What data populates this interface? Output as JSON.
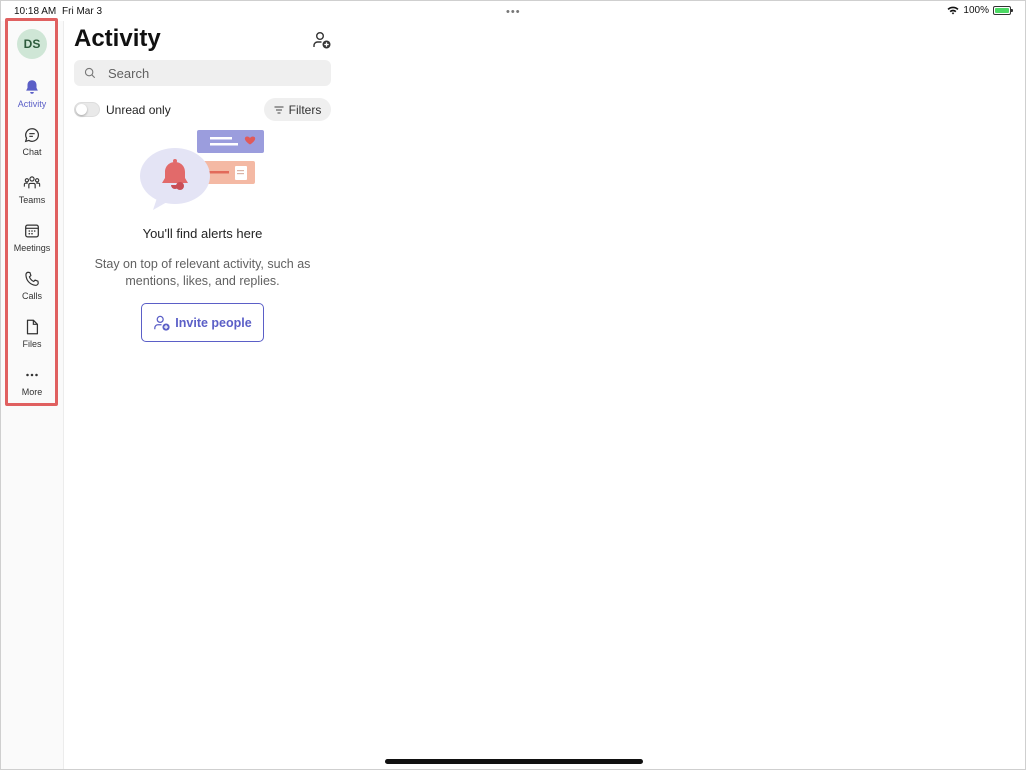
{
  "status_bar": {
    "time": "10:18 AM",
    "date": "Fri Mar 3",
    "battery": "100%"
  },
  "sidebar": {
    "avatar_initials": "DS",
    "items": [
      {
        "label": "Activity",
        "icon": "bell-icon",
        "active": true
      },
      {
        "label": "Chat",
        "icon": "chat-icon"
      },
      {
        "label": "Teams",
        "icon": "teams-icon"
      },
      {
        "label": "Meetings",
        "icon": "calendar-icon"
      },
      {
        "label": "Calls",
        "icon": "phone-icon"
      },
      {
        "label": "Files",
        "icon": "file-icon"
      },
      {
        "label": "More",
        "icon": "more-icon"
      }
    ]
  },
  "main": {
    "title": "Activity",
    "search_placeholder": "Search",
    "unread_toggle_label": "Unread only",
    "unread_toggle_on": false,
    "filters_label": "Filters",
    "empty_state": {
      "title": "You'll find alerts here",
      "body": "Stay on top of relevant activity, such as mentions, likes, and replies.",
      "invite_button": "Invite people"
    }
  },
  "colors": {
    "accent": "#5b5fc7",
    "highlight": "#e06060",
    "avatar_bg": "#cfe6d6"
  }
}
